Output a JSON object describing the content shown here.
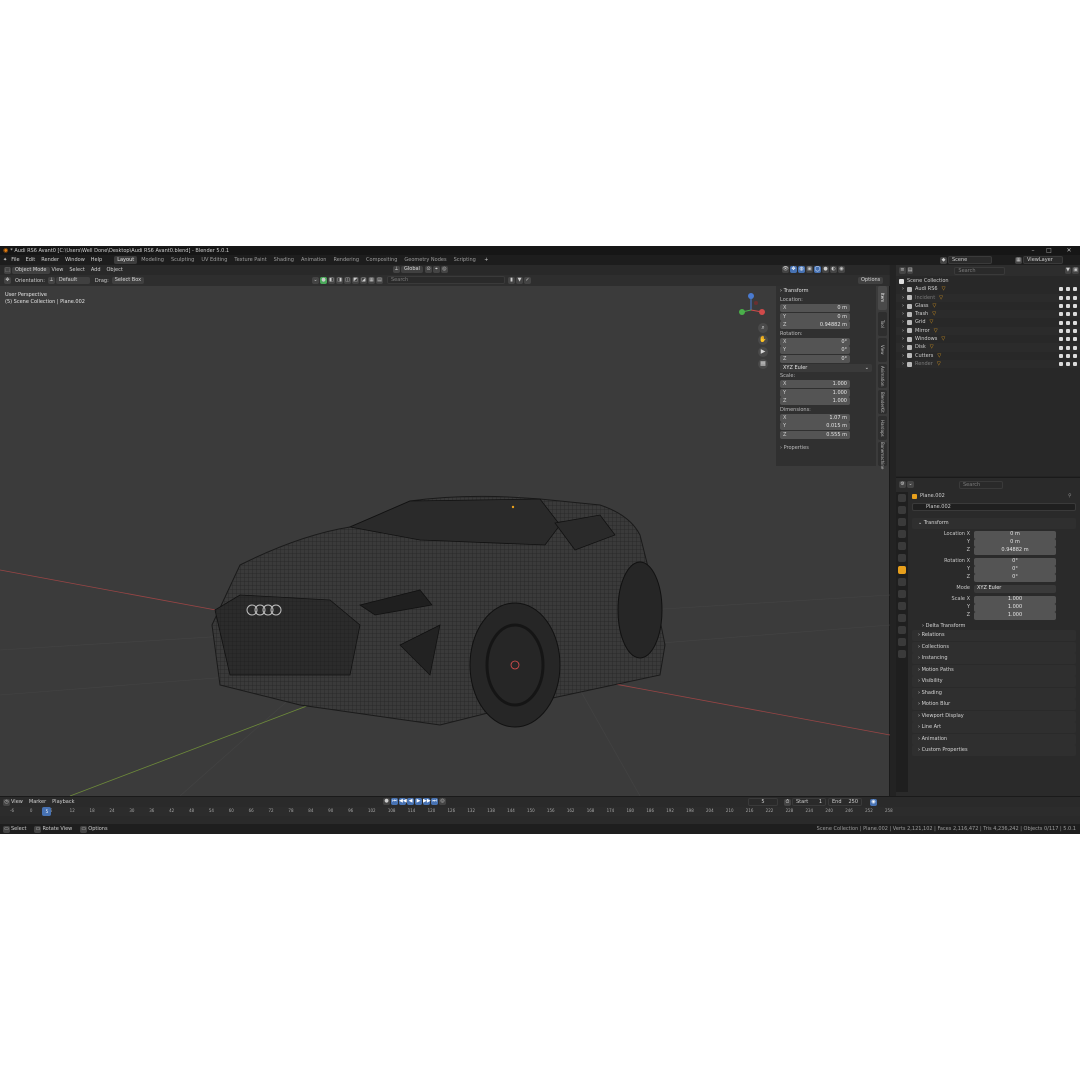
{
  "window": {
    "title": "* Audi RS6 Avant0 [C:\\Users\\Well Done\\Desktop\\Audi RS6 Avant0.blend] - Blender 5.0.1"
  },
  "menubar": {
    "menus": [
      "File",
      "Edit",
      "Render",
      "Window",
      "Help"
    ],
    "workspaces": [
      "Layout",
      "Modeling",
      "Sculpting",
      "UV Editing",
      "Texture Paint",
      "Shading",
      "Animation",
      "Rendering",
      "Compositing",
      "Geometry Nodes",
      "Scripting"
    ],
    "active_workspace": "Layout",
    "scene": "Scene",
    "view_layer": "ViewLayer"
  },
  "viewport": {
    "mode": "Object Mode",
    "menus": [
      "View",
      "Select",
      "Add",
      "Object"
    ],
    "transform_orientation": "Global",
    "tool": {
      "orientation_label": "Orientation:",
      "orientation_value": "Default",
      "drag_label": "Drag:",
      "drag_value": "Select Box"
    },
    "search_placeholder": "Search",
    "options": "Options",
    "overlay_title": "User Perspective",
    "overlay_subtitle": "(5) Scene Collection | Plane.002",
    "colors": {
      "background": "#3b3b3b",
      "grid_x": "#a04040",
      "grid_y": "#6a8a3a",
      "wire": "#111111",
      "accent": "#4772b3"
    }
  },
  "npanel": {
    "title": "Transform",
    "location_label": "Location:",
    "location": [
      {
        "k": "X",
        "v": "0 m"
      },
      {
        "k": "Y",
        "v": "0 m"
      },
      {
        "k": "Z",
        "v": "0.94882 m"
      }
    ],
    "rotation_label": "Rotation:",
    "rotation": [
      {
        "k": "X",
        "v": "0°"
      },
      {
        "k": "Y",
        "v": "0°"
      },
      {
        "k": "Z",
        "v": "0°"
      }
    ],
    "rotation_mode": "XYZ Euler",
    "scale_label": "Scale:",
    "scale": [
      {
        "k": "X",
        "v": "1.000"
      },
      {
        "k": "Y",
        "v": "1.000"
      },
      {
        "k": "Z",
        "v": "1.000"
      }
    ],
    "dimensions_label": "Dimensions:",
    "dimensions": [
      {
        "k": "X",
        "v": "1.07 m"
      },
      {
        "k": "Y",
        "v": "0.015 m"
      },
      {
        "k": "Z",
        "v": "0.555 m"
      }
    ],
    "properties": "Properties",
    "tabs": [
      "Item",
      "Tool",
      "View",
      "Animation",
      "BlenderKit",
      "Hardops",
      "Bonemachine"
    ]
  },
  "outliner": {
    "search_placeholder": "Search",
    "root": "Scene Collection",
    "items": [
      {
        "name": "Audi RS6",
        "dim": false
      },
      {
        "name": "Incident",
        "dim": true
      },
      {
        "name": "Glass",
        "dim": false
      },
      {
        "name": "Trash",
        "dim": false
      },
      {
        "name": "Grid",
        "dim": false
      },
      {
        "name": "Mirror",
        "dim": false
      },
      {
        "name": "Windows",
        "dim": false
      },
      {
        "name": "Disk",
        "dim": false
      },
      {
        "name": "Cutters",
        "dim": false
      },
      {
        "name": "Render",
        "dim": true
      }
    ]
  },
  "properties": {
    "search_placeholder": "Search",
    "object_name": "Plane.002",
    "data_name": "Plane.002",
    "transform": "Transform",
    "location_x_label": "Location X",
    "location": [
      "0 m",
      "0 m",
      "0.94882 m"
    ],
    "rotation_x_label": "Rotation X",
    "rotation": [
      "0°",
      "0°",
      "0°"
    ],
    "mode_label": "Mode",
    "mode": "XYZ Euler",
    "scale_x_label": "Scale X",
    "scale": [
      "1.000",
      "1.000",
      "1.000"
    ],
    "y_label": "Y",
    "z_label": "Z",
    "delta_transform": "Delta Transform",
    "sections": [
      "Relations",
      "Collections",
      "Instancing",
      "Motion Paths",
      "Visibility",
      "Shading",
      "Motion Blur",
      "Viewport Display",
      "Line Art",
      "Animation",
      "Custom Properties"
    ]
  },
  "timeline": {
    "menus": [
      "View",
      "Marker",
      "Playback"
    ],
    "current_frame": "5",
    "start_label": "Start",
    "start": "1",
    "end_label": "End",
    "end": "250",
    "ticks": [
      "-6",
      "0",
      "6",
      "12",
      "18",
      "24",
      "30",
      "36",
      "42",
      "48",
      "54",
      "60",
      "66",
      "72",
      "78",
      "84",
      "90",
      "96",
      "102",
      "108",
      "114",
      "120",
      "126",
      "132",
      "138",
      "144",
      "150",
      "156",
      "162",
      "168",
      "174",
      "180",
      "186",
      "192",
      "198",
      "204",
      "210",
      "216",
      "222",
      "228",
      "234",
      "240",
      "246",
      "252",
      "258"
    ]
  },
  "statusbar": {
    "left": [
      "Select",
      "Rotate View",
      "Options"
    ],
    "right": "Scene Collection | Plane.002 | Verts 2,121,102 | Faces 2,116,472 | Tris 4,236,242 | Objects 0/117 | 5.0.1"
  }
}
